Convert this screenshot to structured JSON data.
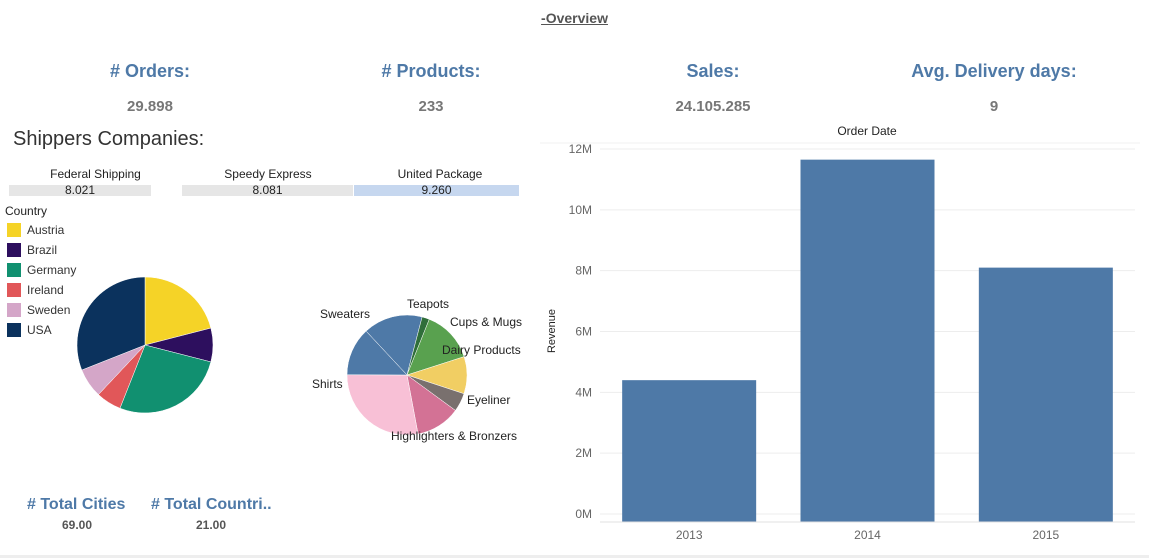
{
  "title": "-Overview",
  "kpis": [
    {
      "label": "# Orders:",
      "value": "29.898"
    },
    {
      "label": "# Products:",
      "value": "233"
    },
    {
      "label": "Sales:",
      "value": "24.105.285"
    },
    {
      "label": "Avg. Delivery days:",
      "value": "9"
    }
  ],
  "shippers": {
    "title": "Shippers Companies:",
    "items": [
      {
        "name": "Federal Shipping",
        "value": "8.021",
        "color": "#e6e6e6"
      },
      {
        "name": "Speedy Express",
        "value": "8.081",
        "color": "#e6e6e6"
      },
      {
        "name": "United Package",
        "value": "9.260",
        "color": "#c6d7ef"
      }
    ]
  },
  "country_legend": {
    "title": "Country",
    "items": [
      {
        "label": "Austria",
        "color": "#f5d327"
      },
      {
        "label": "Brazil",
        "color": "#2d0f5e"
      },
      {
        "label": "Germany",
        "color": "#119070"
      },
      {
        "label": "Ireland",
        "color": "#e15759"
      },
      {
        "label": "Sweden",
        "color": "#d4a6c8"
      },
      {
        "label": "USA",
        "color": "#0b325d"
      }
    ]
  },
  "totals": [
    {
      "label": "# Total Cities",
      "value": "69.00"
    },
    {
      "label": "# Total Countri..",
      "value": "21.00"
    }
  ],
  "chart_data": [
    {
      "type": "pie",
      "labels": [
        "Austria",
        "Brazil",
        "Germany",
        "Ireland",
        "Sweden",
        "USA"
      ],
      "values": [
        21,
        8,
        27,
        6,
        7,
        31
      ],
      "colors": [
        "#f5d327",
        "#2d0f5e",
        "#119070",
        "#e15759",
        "#d4a6c8",
        "#0b325d"
      ]
    },
    {
      "type": "pie",
      "labels": [
        "Teapots",
        "Cups & Mugs",
        "Dairy Products",
        "Eyeliner",
        "",
        "Highlighters & Bronzers",
        "Shirts",
        "Sweaters"
      ],
      "values": [
        16,
        2,
        14,
        10,
        5,
        12,
        28,
        13
      ],
      "colors": [
        "#4e79a7",
        "#2f6e3a",
        "#59a14f",
        "#f1ce63",
        "#79706e",
        "#d37295",
        "#f8c0d6",
        "#4e79a7"
      ]
    },
    {
      "type": "bar",
      "title": "Order Date",
      "ylabel": "Revenue",
      "categories": [
        "2013",
        "2014",
        "2015"
      ],
      "values": [
        4.4,
        11.65,
        8.1
      ],
      "ylim": [
        0,
        12
      ],
      "ytick_values": [
        0,
        2,
        4,
        6,
        8,
        10,
        12
      ],
      "ytick_labels": [
        "0M",
        "2M",
        "4M",
        "6M",
        "8M",
        "10M",
        "12M"
      ],
      "color": "#4e79a7",
      "grid": true
    }
  ]
}
